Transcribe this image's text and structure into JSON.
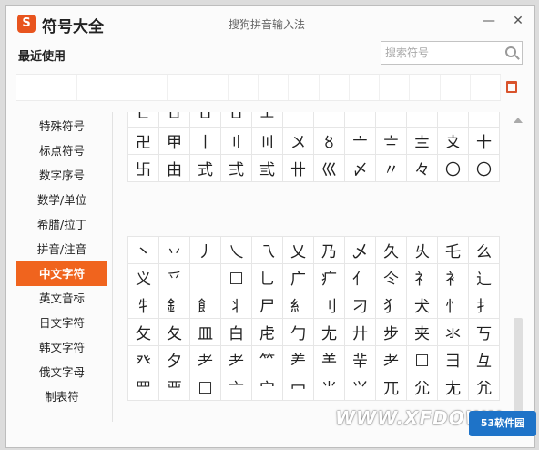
{
  "window": {
    "logo_glyph": "S",
    "app_title": "符号大全",
    "ime_title": "搜狗拼音输入法",
    "minimize_glyph": "—",
    "close_glyph": "✕"
  },
  "recent": {
    "label": "最近使用",
    "cells": [
      "",
      "",
      "",
      "",
      "",
      "",
      "",
      "",
      "",
      "",
      "",
      "",
      "",
      "",
      "",
      ""
    ]
  },
  "search": {
    "placeholder": "搜索符号"
  },
  "categories": [
    {
      "label": "特殊符号"
    },
    {
      "label": "标点符号"
    },
    {
      "label": "数字序号"
    },
    {
      "label": "数学/单位"
    },
    {
      "label": "希腊/拉丁"
    },
    {
      "label": "拼音/注音"
    },
    {
      "label": "中文字符",
      "active": true
    },
    {
      "label": "英文音标"
    },
    {
      "label": "日文字符"
    },
    {
      "label": "韩文字符"
    },
    {
      "label": "俄文字母"
    },
    {
      "label": "制表符"
    }
  ],
  "symbols_top": [
    [
      "ㄴ",
      "ㅁ",
      "ㅁ",
      "ㅁ",
      "ㅗ",
      "",
      "",
      "",
      "",
      "",
      "",
      ""
    ],
    [
      "卍",
      "甲",
      "丨",
      "〢",
      "〣",
      "〤",
      "〥",
      "〦",
      "〧",
      "〨",
      "〩",
      "十"
    ],
    [
      "卐",
      "由",
      "式",
      "弍",
      "弎",
      "卄",
      "巛",
      "〆",
      "〃",
      "々",
      "〇",
      "〇"
    ]
  ],
  "symbols_bottom": [
    [
      "丶",
      "丷",
      "丿",
      "乀",
      "乁",
      "乂",
      "乃",
      "乄",
      "久",
      "乆",
      "乇",
      "么"
    ],
    [
      "义",
      "乊",
      "",
      "□",
      "乚",
      "广",
      "疒",
      "亻",
      "仒",
      "礻",
      "衤",
      "辶"
    ],
    [
      "牜",
      "釒",
      "飠",
      "丬",
      "尸",
      "糹",
      "刂",
      "刁",
      "犭",
      "犬",
      "忄",
      "扌"
    ],
    [
      "攵",
      "夂",
      "皿",
      "白",
      "虍",
      "勹",
      "尢",
      "廾",
      "步",
      "夹",
      "氺",
      "丂"
    ],
    [
      "癶",
      "夕",
      "耂",
      "耂",
      "⺮",
      "⺶",
      "⺷",
      "⺸",
      "⺹",
      "□",
      "彐",
      "彑"
    ],
    [
      "罒",
      "覀",
      "□",
      "亠",
      "宀",
      "冖",
      "⺌",
      "⺍",
      "⺎",
      "⺏",
      "⺐",
      "⺑"
    ]
  ],
  "watermark": {
    "text": "WWW.XFDOWN",
    "badge": "53软件园"
  },
  "colors": {
    "accent": "#f0641e",
    "logo": "#e8541e",
    "badge": "#1e73c8"
  }
}
